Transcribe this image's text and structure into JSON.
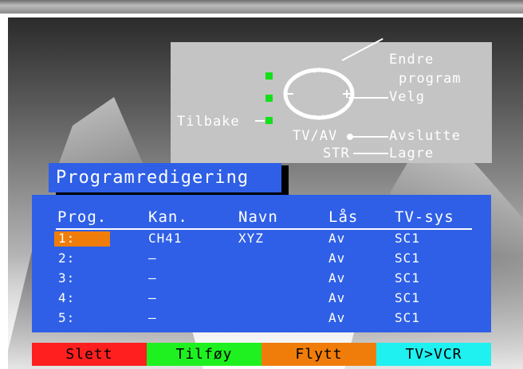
{
  "help": {
    "endre": "Endre",
    "program": "program",
    "velg": "Velg",
    "tilbake": "Tilbake",
    "tvav": "TV/AV",
    "avslutte": "Avslutte",
    "str": "STR",
    "lagre": "Lagre"
  },
  "title": "Programredigering",
  "table": {
    "headers": [
      "Prog.",
      "Kan.",
      "Navn",
      "Lås",
      "TV-sys"
    ],
    "rows": [
      [
        "1:",
        "CH41",
        "XYZ",
        "Av",
        "SC1"
      ],
      [
        "2:",
        "–",
        "",
        "Av",
        "SC1"
      ],
      [
        "3:",
        "–",
        "",
        "Av",
        "SC1"
      ],
      [
        "4:",
        "–",
        "",
        "Av",
        "SC1"
      ],
      [
        "5:",
        "–",
        "",
        "Av",
        "SC1"
      ]
    ],
    "selected_row": 0
  },
  "buttons": [
    {
      "label": "Slett",
      "color": "#ff1f1f"
    },
    {
      "label": "Tilføy",
      "color": "#1ff01f"
    },
    {
      "label": "Flytt",
      "color": "#f07d0a"
    },
    {
      "label": "TV>VCR",
      "color": "#1ff0f0"
    }
  ],
  "colors": {
    "panel": "#2e5fe6",
    "highlight": "#f07d0a",
    "indicator": "#14e01a"
  },
  "icons": [
    "dpad-icon",
    "up-arrow-icon",
    "down-arrow-icon",
    "minus-icon",
    "plus-icon"
  ]
}
